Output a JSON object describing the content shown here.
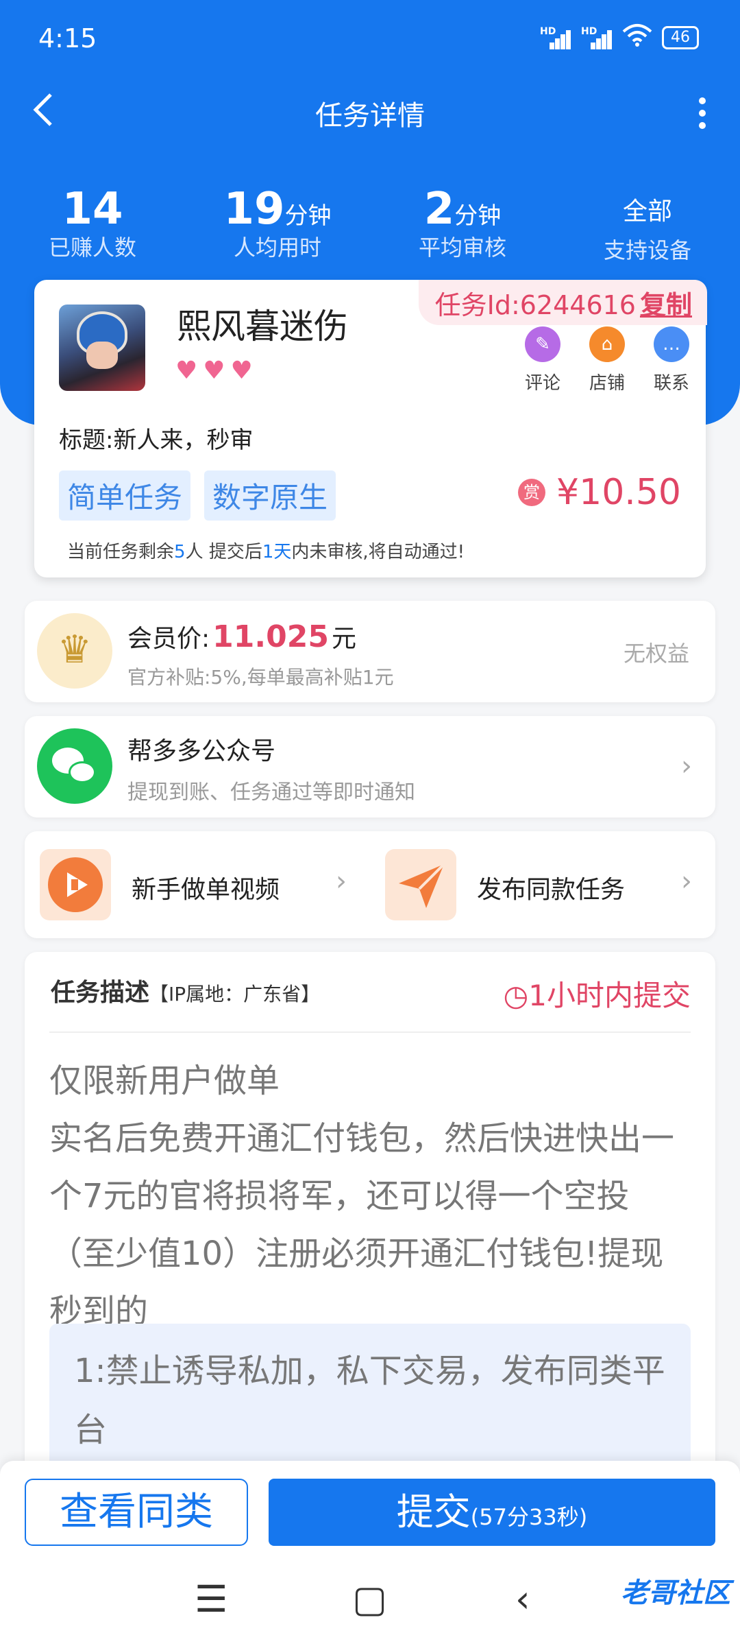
{
  "status_bar": {
    "time": "4:15",
    "battery": "46"
  },
  "nav": {
    "title": "任务详情"
  },
  "stats": [
    {
      "value": "14",
      "unit": "",
      "label": "已赚人数"
    },
    {
      "value": "19",
      "unit": "分钟",
      "label": "人均用时"
    },
    {
      "value": "2",
      "unit": "分钟",
      "label": "平均审核"
    },
    {
      "value": "全部",
      "unit": "",
      "label": "支持设备"
    }
  ],
  "task": {
    "name": "熙风暮迷伤",
    "hearts": "♥♥♥",
    "id_label": "任务Id:6244616",
    "copy_label": "复制",
    "actions": [
      {
        "label": "评论",
        "icon": "comment-icon",
        "color": "#b66be6"
      },
      {
        "label": "店铺",
        "icon": "shop-icon",
        "color": "#f58a2c"
      },
      {
        "label": "联系",
        "icon": "chat-icon",
        "color": "#4a8ef5"
      }
    ],
    "title": "标题:新人来，秒审",
    "tags": [
      "简单任务",
      "数字原生"
    ],
    "reward_badge": "赏",
    "price": "¥10.50",
    "note_prefix": "当前任务剩余",
    "note_count": "5",
    "note_mid": "人  提交后",
    "note_days": "1天",
    "note_suffix": "内未审核,将自动通过!"
  },
  "member": {
    "label": "会员价:",
    "price": "11.025",
    "unit": "元",
    "sub": "官方补贴:5%,每单最高补贴1元",
    "status": "无权益"
  },
  "wechat": {
    "title": "帮多多公众号",
    "sub": "提现到账、任务通过等即时通知"
  },
  "quick": [
    {
      "label": "新手做单视频",
      "icon": "play-video-icon"
    },
    {
      "label": "发布同款任务",
      "icon": "send-plane-icon"
    }
  ],
  "description": {
    "heading": "任务描述",
    "ip": "【IP属地：广东省】",
    "deadline": "1小时内提交",
    "body": "仅限新用户做单\n实名后免费开通汇付钱包，然后快进快出一个7元的官将损将军，还可以得一个空投（至少值10）注册必须开通汇付钱包!提现秒到的",
    "rule": "1:禁止诱导私加，私下交易，发布同类平台"
  },
  "bottom": {
    "similar": "查看同类",
    "submit": "提交",
    "countdown": "(57分33秒)"
  },
  "watermark": "老哥社区",
  "colors": {
    "primary": "#1677ee",
    "accent": "#e04565"
  }
}
